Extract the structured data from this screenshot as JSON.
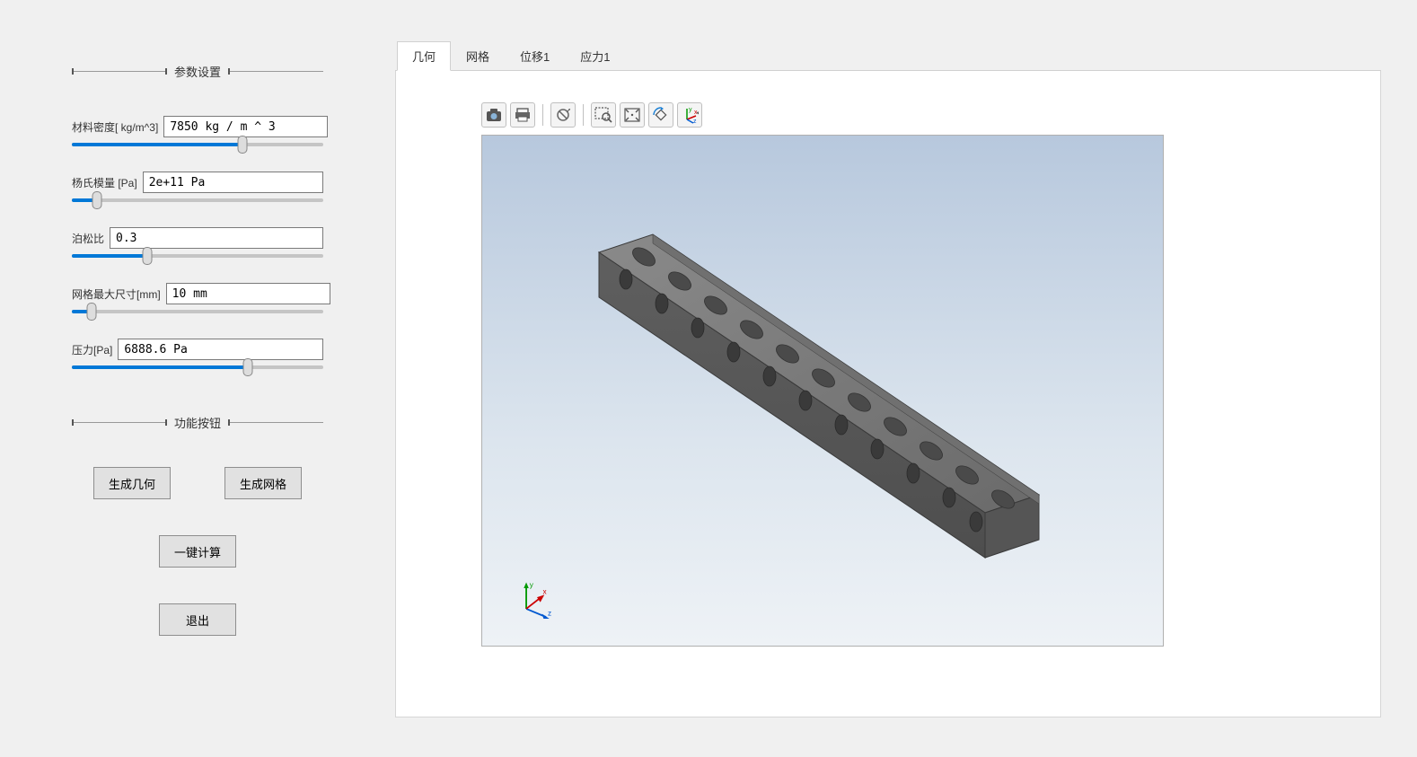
{
  "sidebar": {
    "section_params_title": "参数设置",
    "section_buttons_title": "功能按钮",
    "params": [
      {
        "label": "材料密度[ kg/m^3]",
        "value": "7850 kg / m ^ 3",
        "slider_percent": 68
      },
      {
        "label": "杨氏模量 [Pa]",
        "value": "2e+11 Pa",
        "slider_percent": 10
      },
      {
        "label": "泊松比",
        "value": "0.3",
        "slider_percent": 30
      },
      {
        "label": "网格最大尺寸[mm]",
        "value": "10 mm",
        "slider_percent": 8
      },
      {
        "label": "压力[Pa]",
        "value": "6888.6 Pa",
        "slider_percent": 70
      }
    ],
    "buttons": {
      "gen_geometry": "生成几何",
      "gen_mesh": "生成网格",
      "compute": "一键计算",
      "exit": "退出"
    }
  },
  "tabs": [
    {
      "label": "几何",
      "active": true
    },
    {
      "label": "网格",
      "active": false
    },
    {
      "label": "位移1",
      "active": false
    },
    {
      "label": "应力1",
      "active": false
    }
  ],
  "toolbar": {
    "icons": [
      {
        "name": "camera-icon"
      },
      {
        "name": "print-icon"
      },
      {
        "name": "sep"
      },
      {
        "name": "restore-icon"
      },
      {
        "name": "sep"
      },
      {
        "name": "zoom-window-icon"
      },
      {
        "name": "fit-icon"
      },
      {
        "name": "rotate-icon"
      },
      {
        "name": "axis-triad-icon"
      }
    ]
  },
  "triad": {
    "x": "x",
    "y": "y",
    "z": "z"
  }
}
